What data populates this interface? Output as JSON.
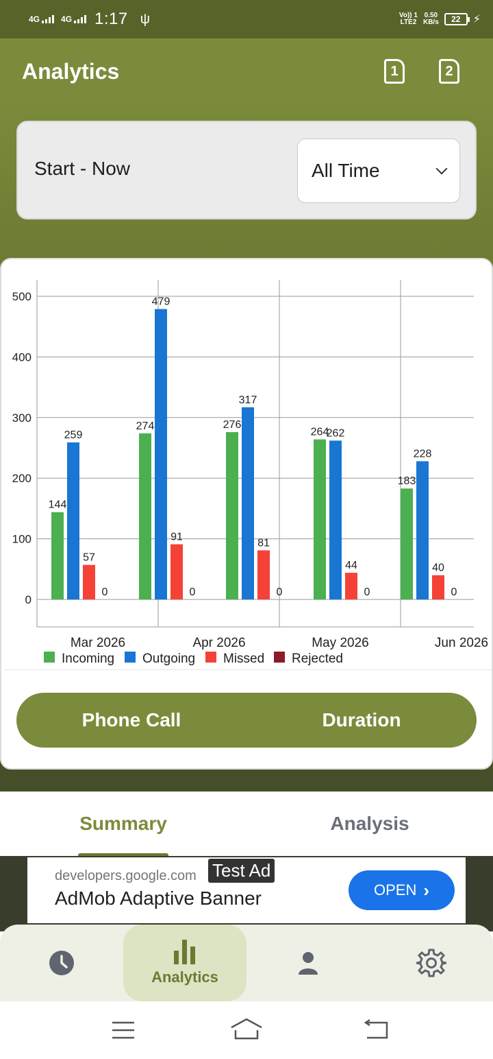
{
  "status_bar": {
    "net1": "4G",
    "net2": "4G",
    "time": "1:17",
    "volte_top": "Vo)) 1",
    "volte_bottom": "LTE2",
    "speed_top": "0.50",
    "speed_bottom": "KB/s",
    "battery": "22"
  },
  "app_bar": {
    "title": "Analytics",
    "sim1": "1",
    "sim2": "2"
  },
  "range": {
    "label": "Start - Now",
    "selected": "All Time"
  },
  "chart_data": {
    "type": "bar",
    "categories": [
      "Mar 2026",
      "Apr 2026",
      "May 2026",
      "Jun 2026"
    ],
    "series": [
      {
        "name": "Incoming",
        "color": "#4caf50",
        "values": [
          144,
          274,
          276,
          264,
          183
        ]
      },
      {
        "name": "Outgoing",
        "color": "#1976d2",
        "values": [
          259,
          479,
          317,
          262,
          228
        ]
      },
      {
        "name": "Missed",
        "color": "#f44336",
        "values": [
          57,
          91,
          81,
          44,
          40
        ]
      },
      {
        "name": "Rejected",
        "color": "#8b1a2b",
        "values": [
          0,
          0,
          0,
          0,
          0
        ]
      }
    ],
    "y_ticks": [
      "500",
      "400",
      "300",
      "200",
      "100",
      "0"
    ],
    "ylim": [
      0,
      500
    ],
    "legend_position": "bottom-left",
    "grid": true
  },
  "toggle": {
    "left": "Phone Call",
    "right": "Duration"
  },
  "tabs": {
    "summary": "Summary",
    "analysis": "Analysis"
  },
  "ad": {
    "url": "developers.google.com",
    "tag": "Test Ad",
    "title": "AdMob Adaptive Banner",
    "open": "OPEN"
  },
  "bottom_nav": {
    "analytics": "Analytics"
  },
  "icons": {
    "clock": "clock-icon",
    "analytics": "bar-chart-icon",
    "person": "person-icon",
    "settings": "gear-icon"
  }
}
